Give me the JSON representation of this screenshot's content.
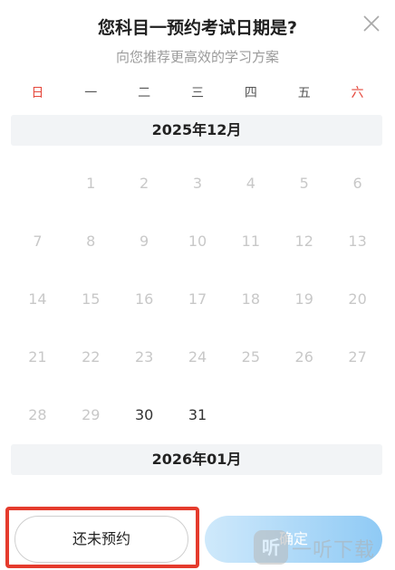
{
  "dialog": {
    "title": "您科目一预约考试日期是?",
    "subtitle": "向您推荐更高效的学习方案",
    "close_icon": "close-icon"
  },
  "weekdays": [
    "日",
    "一",
    "二",
    "三",
    "四",
    "五",
    "六"
  ],
  "colors": {
    "weekend": "#e5473b",
    "disabled_day": "#c8c8c8",
    "active_day": "#333333",
    "month_bar_bg": "#f2f4f6",
    "highlight": "#e53b2d",
    "confirm_gradient_start": "#cfe9fb",
    "confirm_gradient_end": "#8fcaf5"
  },
  "calendar": {
    "months": [
      {
        "label": "2025年12月",
        "weeks": [
          [
            "",
            "1",
            "2",
            "3",
            "4",
            "5",
            "6"
          ],
          [
            "7",
            "8",
            "9",
            "10",
            "11",
            "12",
            "13"
          ],
          [
            "14",
            "15",
            "16",
            "17",
            "18",
            "19",
            "20"
          ],
          [
            "21",
            "22",
            "23",
            "24",
            "25",
            "26",
            "27"
          ],
          [
            "28",
            "29",
            "30",
            "31",
            "",
            "",
            ""
          ]
        ],
        "selectable_days": [
          "30",
          "31"
        ]
      },
      {
        "label": "2026年01月"
      }
    ]
  },
  "buttons": {
    "not_booked": "还未预约",
    "confirm": "确定"
  },
  "watermark": {
    "logo_glyph": "听",
    "text": "一听下载"
  }
}
